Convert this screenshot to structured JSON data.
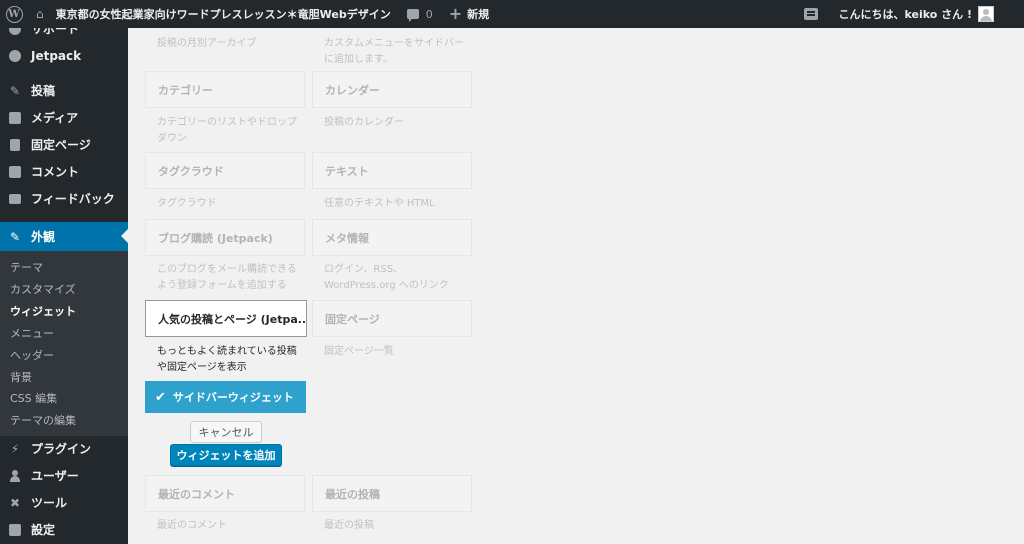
{
  "admin_bar": {
    "site_name": "東京都の女性起業家向けワードプレスレッスン＊竜胆Webデザイン",
    "comments_count": "0",
    "new_label": "新規",
    "greeting": "こんにちは、keiko さん !"
  },
  "sidebar": {
    "items": [
      {
        "label": "サポート",
        "icon": "support-icon"
      },
      {
        "label": "Jetpack",
        "icon": "jetpack-icon"
      },
      {
        "label": "投稿",
        "icon": "pin-icon"
      },
      {
        "label": "メディア",
        "icon": "media-icon"
      },
      {
        "label": "固定ページ",
        "icon": "page-icon"
      },
      {
        "label": "コメント",
        "icon": "comment-icon"
      },
      {
        "label": "フィードバック",
        "icon": "feedback-icon"
      },
      {
        "label": "外観",
        "icon": "appearance-icon"
      },
      {
        "label": "プラグイン",
        "icon": "plugin-icon"
      },
      {
        "label": "ユーザー",
        "icon": "user-icon"
      },
      {
        "label": "ツール",
        "icon": "tool-icon"
      },
      {
        "label": "設定",
        "icon": "settings-icon"
      }
    ],
    "submenu": [
      "テーマ",
      "カスタマイズ",
      "ウィジェット",
      "メニュー",
      "ヘッダー",
      "背景",
      "CSS 編集",
      "テーマの編集"
    ],
    "current_submenu": "ウィジェット"
  },
  "widgets": {
    "col1": [
      {
        "title": "",
        "desc": "投稿の月別アーカイブ"
      },
      {
        "title": "カテゴリー",
        "desc": "カテゴリーのリストやドロップダウン"
      },
      {
        "title": "タグクラウド",
        "desc": "タグクラウド"
      },
      {
        "title": "ブログ購読 (Jetpack)",
        "desc": "このブログをメール購読できるよう登録フォームを追加する"
      },
      {
        "title": "人気の投稿とページ (Jetpa...",
        "desc": "もっともよく読まれている投稿や固定ページを表示"
      },
      {
        "title": "最近のコメント",
        "desc": "最近のコメント"
      }
    ],
    "col2": [
      {
        "title": "",
        "desc": "カスタムメニューをサイドバーに追加します。"
      },
      {
        "title": "カレンダー",
        "desc": "投稿のカレンダー"
      },
      {
        "title": "テキスト",
        "desc": "任意のテキストや HTML"
      },
      {
        "title": "メタ情報",
        "desc": "ログイン、RSS、WordPress.org へのリンク"
      },
      {
        "title": "固定ページ",
        "desc": "固定ページ一覧"
      },
      {
        "title": "最近の投稿",
        "desc": "最近の投稿"
      }
    ]
  },
  "chooser": {
    "sidebar_label": "サイドバーウィジェット",
    "cancel_label": "キャンセル",
    "add_label": "ウィジェットを追加"
  },
  "colors": {
    "admin_bar": "#23282d",
    "active_menu": "#0073aa",
    "chooser_selected": "#2ea2cc",
    "primary_button": "#0085ba"
  }
}
